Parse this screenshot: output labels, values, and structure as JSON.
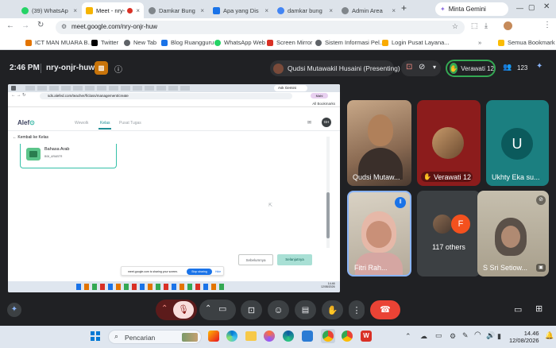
{
  "browser": {
    "tabs": [
      {
        "label": "(39) WhatsAp",
        "color": "#25d366"
      },
      {
        "label": "Meet - nry-",
        "color": "#f6b400",
        "active": true
      },
      {
        "label": "Damkar Bung",
        "color": "#5f6368"
      },
      {
        "label": "Apa yang Dis",
        "color": "#1a73e8"
      },
      {
        "label": "damkar bung",
        "color": "#4285f4"
      },
      {
        "label": "Admin Area",
        "color": "#5f6368"
      }
    ],
    "gemini_button": "Minta Gemini",
    "url": "meet.google.com/nry-onjr-huw",
    "bookmarks": [
      {
        "label": "ICT MAN MUARA B...",
        "color": "#e37400"
      },
      {
        "label": "Twitter",
        "color": "#000000"
      },
      {
        "label": "New Tab",
        "color": "#5f6368"
      },
      {
        "label": "Blog Ruangguru",
        "color": "#1a73e8"
      },
      {
        "label": "WhatsApp Web",
        "color": "#25d366"
      },
      {
        "label": "Screen Mirror",
        "color": "#d93025"
      },
      {
        "label": "Sistem Informasi Pel...",
        "color": "#5f6368"
      },
      {
        "label": "Login Pusat Layana...",
        "color": "#f9ab00"
      }
    ],
    "all_bookmarks": "Semua Bookmark"
  },
  "meet": {
    "time": "2:46 PM",
    "meeting_code": "nry-onjr-huw",
    "presenter": "Qudsi Mutawakil Husaini (Presenting)",
    "host_badge": "Verawati 12",
    "participant_count": "123",
    "tiles": {
      "t1": "Qudsi Mutaw...",
      "t2": "Verawati 12",
      "t3_initial": "U",
      "t3": "Ukhty Eka su...",
      "t4": "Fitri Rah...",
      "t5_initial": "F",
      "t5": "117 others",
      "t6": "S Sri Setiow..."
    },
    "colors": {
      "hangup": "#ea4335",
      "accent": "#8ab4f8",
      "teal": "#1e8e96",
      "host": "#34a853"
    }
  },
  "shared": {
    "url": "sds.alefed.com/teacher/f/class/management/create",
    "gemini": "Ask Gemini",
    "profile": "Mahi",
    "all_bookmarks": "All Bookmarks",
    "logo": "Alef",
    "nav": [
      "Wewolk",
      "Kelas",
      "Pusat Tugas"
    ],
    "avatar": "GH",
    "back": "Kembali ke Kelas",
    "card_title": "Bahasa Arab",
    "card_sub": "B06_ARABTR",
    "btn_prev": "Sebelumnya",
    "btn_next": "Selanjutnya",
    "share_msg": "meet.google.com is sharing your screen.",
    "stop_sharing": "Stop sharing",
    "hide": "Hide",
    "clock_time": "14.46",
    "clock_date": "12/08/2026"
  },
  "taskbar": {
    "search": "Pencarian",
    "time": "14.46",
    "date": "12/08/2026"
  }
}
